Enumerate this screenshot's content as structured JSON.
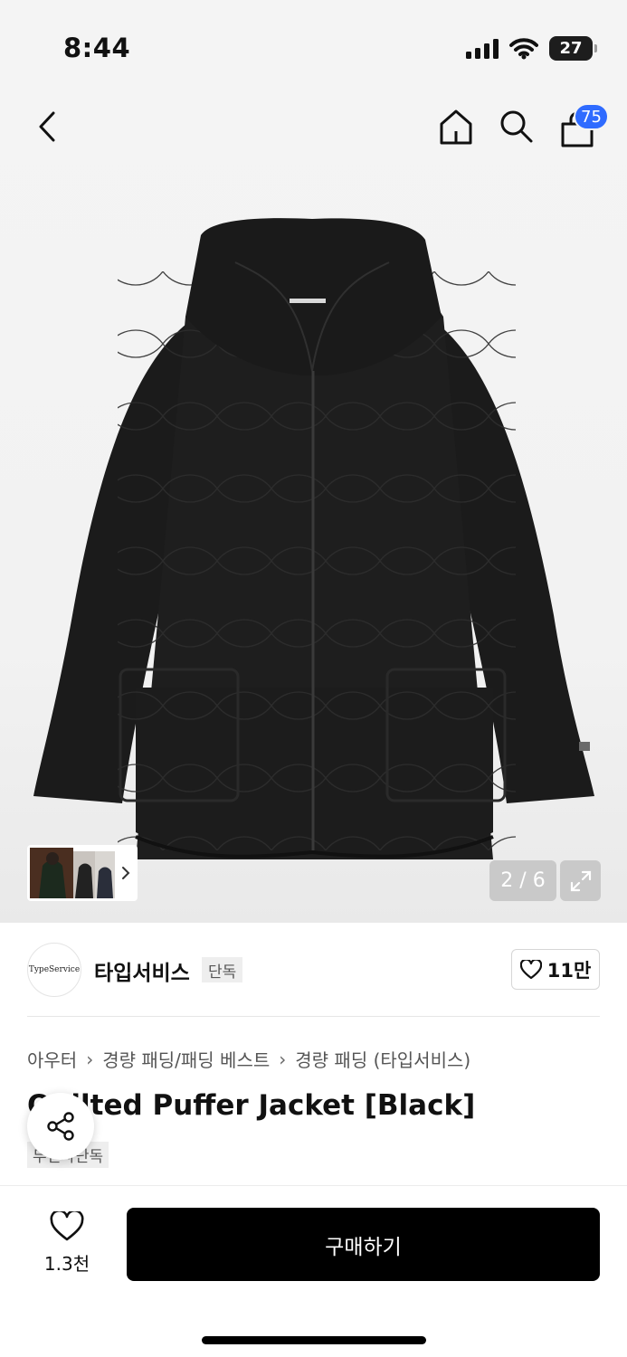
{
  "status_bar": {
    "time": "8:44",
    "battery": "27"
  },
  "header": {
    "cart_count": "75"
  },
  "gallery": {
    "page_counter": "2 / 6"
  },
  "brand": {
    "logo_text": "TypeService",
    "name": "타입서비스",
    "tag": "단독"
  },
  "like": {
    "count": "11만"
  },
  "breadcrumb": [
    "아우터",
    "경량 패딩/패딩 베스트",
    "경량 패딩 (타입서비스)"
  ],
  "product": {
    "title": "Quilted Puffer Jacket [Black]",
    "tag": "무신사단독"
  },
  "bottom": {
    "wish_count": "1.3천",
    "buy_label": "구매하기"
  },
  "colors": {
    "accent": "#2f6bff",
    "buy_button": "#000000",
    "jacket": "#1c1c1c"
  },
  "icons": [
    "back-icon",
    "home-icon",
    "search-icon",
    "bag-icon",
    "chevron-right-icon",
    "expand-icon",
    "heart-icon",
    "share-icon",
    "signal-icon",
    "wifi-icon",
    "battery-icon"
  ]
}
